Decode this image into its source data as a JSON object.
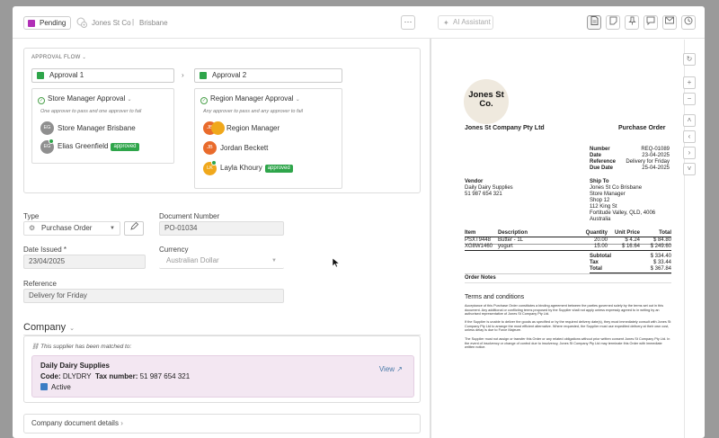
{
  "header": {
    "status": "Pending",
    "breadcrumbs": [
      "Jones St Co",
      "Brisbane"
    ],
    "more_label": "⋯",
    "ai_label": "AI Assistant"
  },
  "approval_flow": {
    "title": "APPROVAL FLOW",
    "approval1": {
      "label": "Approval 1",
      "group": "Store Manager Approval",
      "rule": "One approver to pass and one approver to fail",
      "approvers": [
        {
          "initials": "EG",
          "name": "Store Manager Brisbane",
          "status": ""
        },
        {
          "initials": "EG",
          "name": "Elias Greenfield",
          "status": "approved"
        }
      ]
    },
    "approval2": {
      "label": "Approval 2",
      "group": "Region Manager Approval",
      "rule": "Any approver to pass and any approver to fail",
      "approvers": [
        {
          "initials": "JB",
          "name": "Region Manager",
          "status": ""
        },
        {
          "initials": "JB",
          "name": "Jordan Beckett",
          "status": ""
        },
        {
          "initials": "LK",
          "name": "Layla Khoury",
          "status": "approved"
        }
      ]
    }
  },
  "form": {
    "type_label": "Type",
    "type_value": "Purchase Order",
    "docnum_label": "Document Number",
    "docnum_value": "PO-01034",
    "date_label": "Date Issued *",
    "date_value": "23/04/2025",
    "currency_label": "Currency",
    "currency_value": "Australian Dollar",
    "ref_label": "Reference",
    "ref_value": "Delivery for Friday"
  },
  "company": {
    "section_title": "Company",
    "match_note": "This supplier has been matched to:",
    "name": "Daily Dairy Supplies",
    "code_label": "Code:",
    "code": "DLYDRY",
    "tax_label": "Tax number:",
    "tax": "51 987 654 321",
    "status": "Active",
    "view_label": "View",
    "details_label": "Company document details"
  },
  "document": {
    "logo_text": "Jones St Co.",
    "company_name": "Jones St Company Pty Ltd",
    "doc_title": "Purchase Order",
    "meta": [
      {
        "k": "Number",
        "v": "REQ-01089"
      },
      {
        "k": "Date",
        "v": "23-04-2025"
      },
      {
        "k": "Reference",
        "v": "Delivery for Friday"
      },
      {
        "k": "Due Date",
        "v": "25-04-2025"
      }
    ],
    "vendor_label": "Vendor",
    "vendor_lines": [
      "Daily Dairy Supplies",
      "51 987 654 321"
    ],
    "shipto_label": "Ship To",
    "shipto_lines": [
      "Jones St Co Brisbane",
      "Store Manager",
      "Shop 12",
      "112 King St",
      "Fortitude Valley, QLD, 4006",
      "Australia"
    ],
    "cols": [
      "Item",
      "Description",
      "Quantity",
      "Unit Price",
      "Total"
    ],
    "items": [
      {
        "item": "PSXT9448",
        "desc": "Butter - 1L",
        "qty": "20.00",
        "price": "$ 4.24",
        "total": "$ 84.80"
      },
      {
        "item": "XG8W1460",
        "desc": "yogurt",
        "qty": "15.00",
        "price": "$ 16.64",
        "total": "$ 249.60"
      }
    ],
    "totals": [
      {
        "k": "Subtotal",
        "v": "$ 334.40"
      },
      {
        "k": "Tax",
        "v": "$ 33.44"
      },
      {
        "k": "Total",
        "v": "$ 367.84"
      }
    ],
    "notes_label": "Order Notes",
    "terms_title": "Terms and conditions",
    "terms": [
      "Acceptance of this Purchase Order constitutes a binding agreement between the parties governed solely by the terms set out in this document. Any additional or conflicting terms proposed by the Supplier shall not apply unless expressly agreed to in writing by an authorised representative of Jones St Company Pty Ltd.",
      "If the Supplier is unable to deliver the goods as specified or by the required delivery date(s), they must immediately consult with Jones St Company Pty Ltd to arrange the most efficient alternative. Where requested, the Supplier must use expedited delivery at their own cost, unless delay is due to Force Majeure.",
      "The Supplier must not assign or transfer this Order or any related obligations without prior written consent Jones St Company Pty Ltd. In the event of insolvency or change of control due to insolvency, Jones St Company Pty Ltd may terminate this Order with immediate written notice."
    ]
  }
}
